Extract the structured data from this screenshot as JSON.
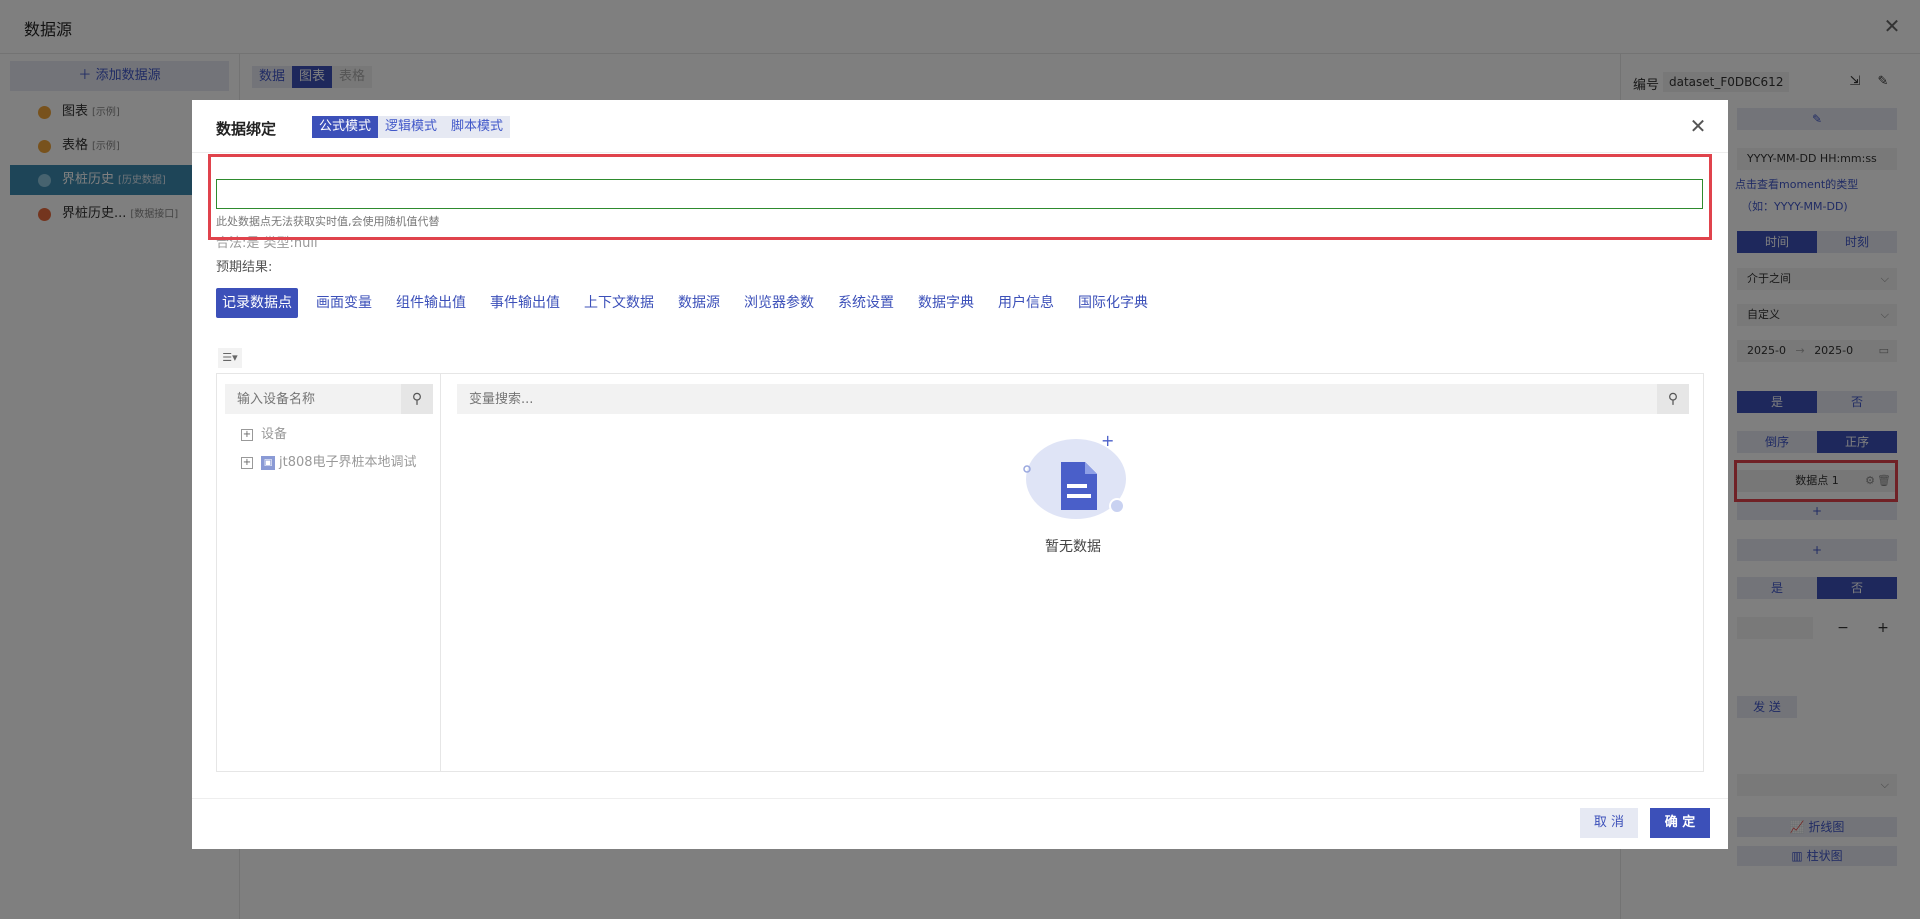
{
  "background": {
    "title": "数据源",
    "add_source": "添加数据源",
    "sources": [
      {
        "name": "图表",
        "tag": "[示例]"
      },
      {
        "name": "表格",
        "tag": "[示例]"
      },
      {
        "name": "界桩历史",
        "tag": "[历史数据]"
      },
      {
        "name": "界桩历史...",
        "tag": "[数据接口]"
      }
    ],
    "tabs": [
      "数据",
      "图表",
      "表格"
    ],
    "right": {
      "code_label": "编号",
      "code_value": "dataset_F0DBC612",
      "time_format": "YYYY-MM-DD HH:mm:ss",
      "moment_link": "点击查看moment的类型",
      "moment_example": "（如：YYYY-MM-DD)",
      "seg_time": [
        "时间",
        "时刻"
      ],
      "between": "介于之间",
      "custom": "自定义",
      "date_start": "2025-0",
      "date_end": "2025-0",
      "yes_no_1": [
        "是",
        "否"
      ],
      "order": [
        "倒序",
        "正序"
      ],
      "data_point": "数据点 1",
      "plus": "+",
      "yes_no_2": [
        "是",
        "否"
      ],
      "minus": "−",
      "send": "发 送",
      "line_chart": "折线图",
      "bar_chart": "柱状图"
    }
  },
  "modal": {
    "title": "数据绑定",
    "modes": [
      "公式模式",
      "逻辑模式",
      "脚本模式"
    ],
    "formula_value": "",
    "hint": "此处数据点无法获取实时值,会使用随机值代替",
    "result": "合法:是    类型:null",
    "expected": "预期结果:",
    "source_tabs": [
      "记录数据点",
      "画面变量",
      "组件输出值",
      "事件输出值",
      "上下文数据",
      "数据源",
      "浏览器参数",
      "系统设置",
      "数据字典",
      "用户信息",
      "国际化字典"
    ],
    "device_search_placeholder": "输入设备名称",
    "var_search_placeholder": "变量搜索...",
    "tree": [
      {
        "label": "设备"
      },
      {
        "label": "jt808电子界桩本地调试"
      }
    ],
    "empty": "暂无数据",
    "cancel": "取 消",
    "ok": "确 定"
  }
}
